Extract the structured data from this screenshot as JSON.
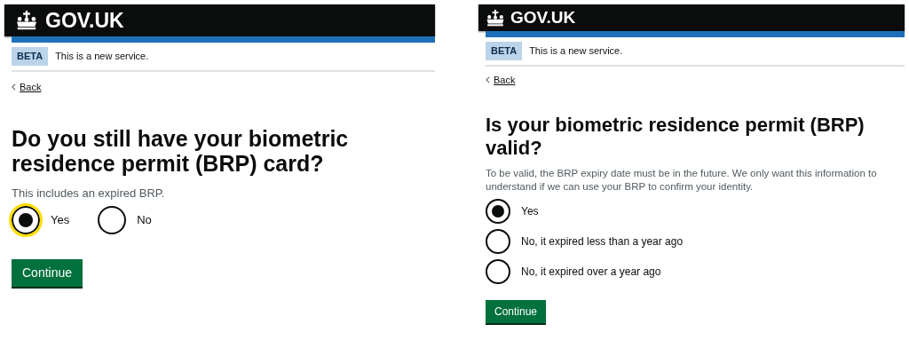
{
  "screens": [
    {
      "logo": "GOV.UK",
      "phase": {
        "tag": "BETA",
        "text": "This is a new service."
      },
      "back": "Back",
      "heading": "Do you still have your biometric residence permit (BRP) card?",
      "hint": "This includes an expired BRP.",
      "kind": "inline",
      "options": [
        {
          "label": "Yes",
          "selected": true,
          "focused": true
        },
        {
          "label": "No",
          "selected": false,
          "focused": false
        }
      ],
      "button": "Continue"
    },
    {
      "logo": "GOV.UK",
      "phase": {
        "tag": "BETA",
        "text": "This is a new service."
      },
      "back": "Back",
      "heading": "Is your biometric residence permit (BRP) valid?",
      "hint": "To be valid, the BRP expiry date must be in the future. We only want this information to understand if we can use your BRP to confirm your identity.",
      "kind": "stacked",
      "options": [
        {
          "label": "Yes",
          "selected": true,
          "focused": false
        },
        {
          "label": "No, it expired less than a year ago",
          "selected": false,
          "focused": false
        },
        {
          "label": "No, it expired over a year ago",
          "selected": false,
          "focused": false
        }
      ],
      "button": "Continue"
    }
  ]
}
